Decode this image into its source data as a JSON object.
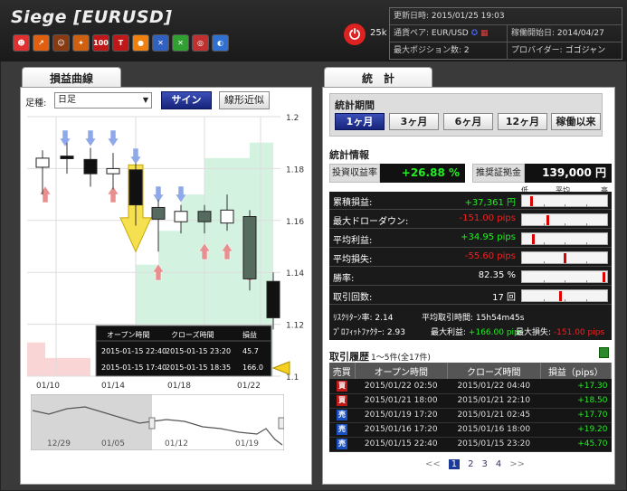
{
  "app": {
    "title": "Siege [EURUSD]"
  },
  "toolbar": {
    "icons": [
      {
        "name": "smiley-icon",
        "color": "#e03030",
        "glyph": "☻"
      },
      {
        "name": "chart-icon",
        "color": "#e06010",
        "glyph": "↗"
      },
      {
        "name": "people-icon",
        "color": "#8a3a10",
        "glyph": "☺"
      },
      {
        "name": "boomerang-icon",
        "color": "#d06010",
        "glyph": "✦"
      },
      {
        "name": "top100-icon",
        "color": "#c01818",
        "glyph": "100"
      },
      {
        "name": "t100-icon",
        "color": "#c01818",
        "glyph": "T"
      },
      {
        "name": "orange-ball-icon",
        "color": "#f08010",
        "glyph": "●"
      },
      {
        "name": "flag-icon",
        "color": "#3060c0",
        "glyph": "✕"
      },
      {
        "name": "arrows-icon",
        "color": "#30a030",
        "glyph": "✕"
      },
      {
        "name": "target-icon",
        "color": "#c03030",
        "glyph": "◎"
      },
      {
        "name": "globe-icon",
        "color": "#3070d0",
        "glyph": "◐"
      }
    ],
    "power_count": "25k"
  },
  "info": {
    "updated_label": "更新日時:",
    "updated_value": "2015/01/25 19:03",
    "pair_label": "通貨ペア:",
    "pair_value": "EUR/USD",
    "start_label": "稼働開始日:",
    "start_value": "2014/04/27",
    "maxpos_label": "最大ポジション数:",
    "maxpos_value": "2",
    "provider_label": "プロバイダー:",
    "provider_value": "ゴゴジャン"
  },
  "left": {
    "tab": "損益曲線",
    "ashi_label": "足種:",
    "ashi_value": "日足",
    "sign_button": "サイン",
    "linear_button": "線形近似"
  },
  "chart_data": {
    "type": "candlestick",
    "ylim": [
      1.1,
      1.2
    ],
    "y_ticks": [
      "1.2",
      "1.18",
      "1.16",
      "1.14",
      "1.12",
      "1.1"
    ],
    "x_ticks": [
      "01/10",
      "01/14",
      "01/18",
      "01/22"
    ],
    "candles": [
      {
        "x": 0,
        "open": 1.1805,
        "close": 1.184,
        "high": 1.187,
        "low": 1.17,
        "color": "white"
      },
      {
        "x": 1,
        "open": 1.1848,
        "close": 1.1838,
        "high": 1.19,
        "low": 1.178,
        "color": "black"
      },
      {
        "x": 2,
        "open": 1.1835,
        "close": 1.178,
        "high": 1.188,
        "low": 1.173,
        "color": "black"
      },
      {
        "x": 3,
        "open": 1.178,
        "close": 1.18,
        "high": 1.186,
        "low": 1.172,
        "color": "white"
      },
      {
        "x": 4,
        "open": 1.1795,
        "close": 1.166,
        "high": 1.182,
        "low": 1.158,
        "color": "black"
      },
      {
        "x": 5,
        "open": 1.1605,
        "close": 1.165,
        "high": 1.168,
        "low": 1.148,
        "color": "black"
      },
      {
        "x": 6,
        "open": 1.1595,
        "close": 1.1635,
        "high": 1.166,
        "low": 1.155,
        "color": "white"
      },
      {
        "x": 7,
        "open": 1.1595,
        "close": 1.1635,
        "high": 1.166,
        "low": 1.155,
        "color": "black"
      },
      {
        "x": 8,
        "open": 1.159,
        "close": 1.164,
        "high": 1.17,
        "low": 1.156,
        "color": "white"
      },
      {
        "x": 9,
        "open": 1.1615,
        "close": 1.1375,
        "high": 1.164,
        "low": 1.133,
        "color": "black"
      },
      {
        "x": 10,
        "open": 1.1365,
        "close": 1.1225,
        "high": 1.14,
        "low": 1.118,
        "color": "black"
      }
    ],
    "trade_popup": {
      "headers": [
        "オープン時間",
        "クローズ時間",
        "損益"
      ],
      "rows": [
        [
          "2015-01-15 22:40",
          "2015-01-15 23:20",
          "45.7"
        ],
        [
          "2015-01-15 17:40",
          "2015-01-15 18:35",
          "166.0"
        ]
      ]
    },
    "navigator_x_ticks": [
      "12/29",
      "01/05",
      "01/12",
      "01/19"
    ]
  },
  "right": {
    "tab": "統　計",
    "period_title": "統計期間",
    "periods": [
      "1ヶ月",
      "3ヶ月",
      "6ヶ月",
      "12ヶ月",
      "稼働以来"
    ],
    "stats_title": "統計情報",
    "roi_label": "投資収益率",
    "roi_value": "+26.88 %",
    "recommended_label": "推奨証拠金",
    "recommended_value": "139,000 円",
    "scale_low": "低",
    "scale_mid": "平均",
    "scale_high": "高",
    "metrics": [
      {
        "label": "累積損益:",
        "value": "+37,361 円",
        "color": "#2e2",
        "level": 0.1
      },
      {
        "label": "最大ドローダウン:",
        "value": "-151.00 pips",
        "color": "#e22",
        "level": 0.3
      },
      {
        "label": "平均利益:",
        "value": "+34.95 pips",
        "color": "#2e2",
        "level": 0.12
      },
      {
        "label": "平均損失:",
        "value": "-55.60 pips",
        "color": "#e22",
        "level": 0.5
      },
      {
        "label": "勝率:",
        "value": "82.35 %",
        "color": "#fff",
        "level": 0.98
      },
      {
        "label": "取引回数:",
        "value": "17 回",
        "color": "#fff",
        "level": 0.45
      }
    ],
    "risk_reward_label": "ﾘｽｸﾘﾀｰﾝ率:",
    "risk_reward_value": "2.14",
    "avg_time_label": "平均取引時間:",
    "avg_time_value": "15h54m45s",
    "profit_factor_label": "ﾌﾟﾛﾌｨｯﾄﾌｧｸﾀｰ:",
    "profit_factor_value": "2.93",
    "max_profit_label": "最大利益:",
    "max_profit_value": "+166.00 pips",
    "max_loss_label": "最大損失:",
    "max_loss_value": "-151.00 pips",
    "history_title": "取引履歴",
    "history_count": "1〜5件(全17件)",
    "history_headers": [
      "売買",
      "オープン時間",
      "クローズ時間",
      "損益（pips）"
    ],
    "history_rows": [
      {
        "side": "買",
        "type": "buy",
        "open": "2015/01/22 02:50",
        "close": "2015/01/22 04:40",
        "pnl": "+17.30"
      },
      {
        "side": "買",
        "type": "buy",
        "open": "2015/01/21 18:00",
        "close": "2015/01/21 22:10",
        "pnl": "+18.50"
      },
      {
        "side": "売",
        "type": "sell",
        "open": "2015/01/19 17:20",
        "close": "2015/01/21 02:45",
        "pnl": "+17.70"
      },
      {
        "side": "売",
        "type": "sell",
        "open": "2015/01/16 17:20",
        "close": "2015/01/16 18:00",
        "pnl": "+19.20"
      },
      {
        "side": "売",
        "type": "sell",
        "open": "2015/01/15 22:40",
        "close": "2015/01/15 23:20",
        "pnl": "+45.70"
      }
    ],
    "pager": {
      "prev": "<<",
      "pages": [
        "1",
        "2",
        "3",
        "4"
      ],
      "next": ">>"
    }
  }
}
